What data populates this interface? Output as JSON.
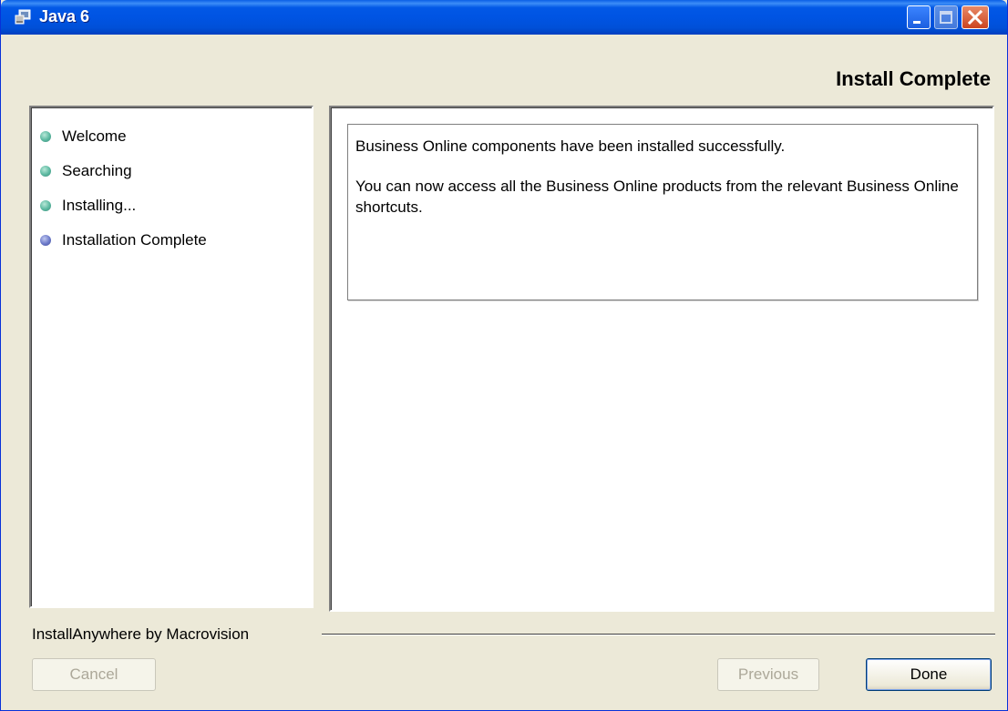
{
  "window": {
    "title": "Java 6",
    "controls": [
      "minimize-icon",
      "maximize-icon",
      "close-icon"
    ]
  },
  "header": {
    "page_title": "Install Complete"
  },
  "steps": [
    {
      "label": "Welcome",
      "status": "done"
    },
    {
      "label": "Searching",
      "status": "done"
    },
    {
      "label": "Installing...",
      "status": "done"
    },
    {
      "label": "Installation Complete",
      "status": "current"
    }
  ],
  "content": {
    "line1": "Business Online components have been installed successfully.",
    "line2": "You can now access all the Business Online products from the relevant Business Online shortcuts."
  },
  "footer": {
    "vendor": "InstallAnywhere by Macrovision",
    "cancel_label": "Cancel",
    "previous_label": "Previous",
    "done_label": "Done"
  },
  "colors": {
    "titlebar": "#0054e3",
    "background": "#ece9d8",
    "step_done": "#5ab8a0",
    "step_current": "#6a78c8"
  }
}
